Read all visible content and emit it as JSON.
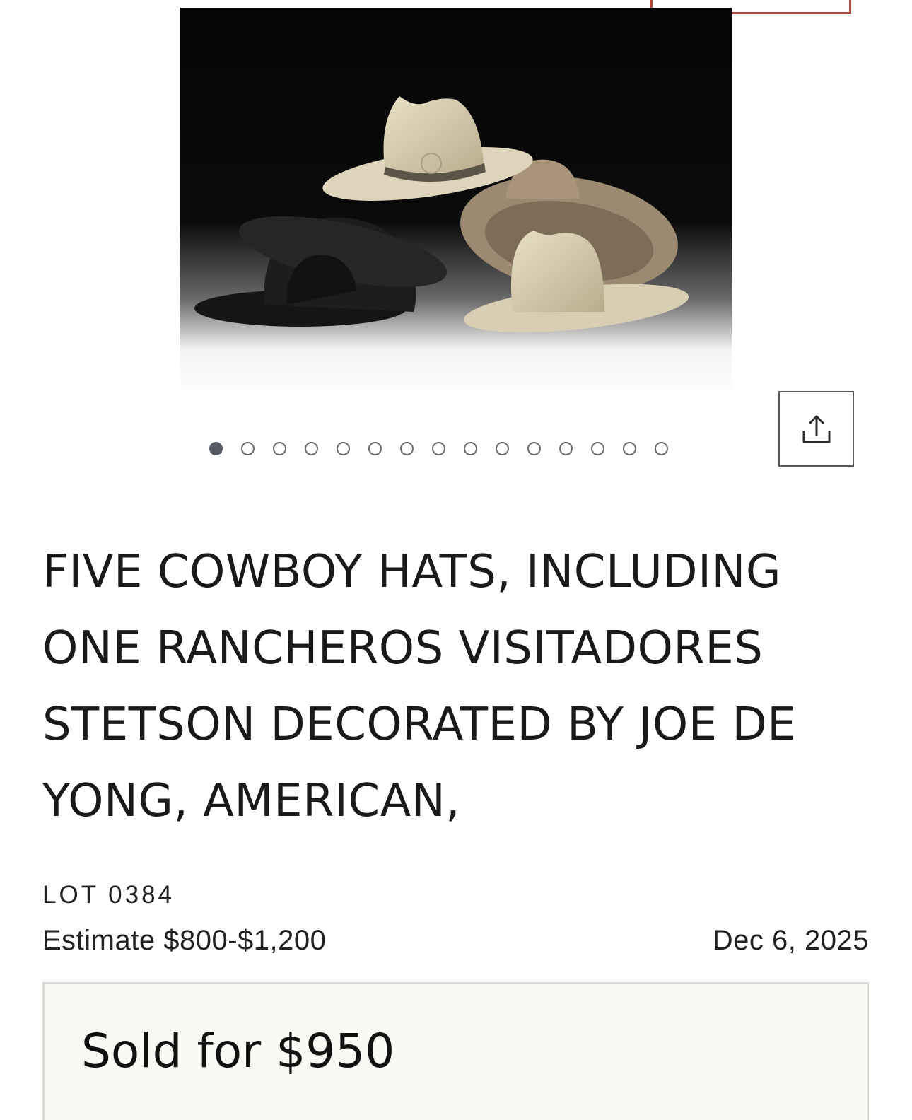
{
  "gallery": {
    "image_alt": "Five cowboy hats photographed on a black background",
    "dot_count": 15,
    "active_dot_index": 0
  },
  "share": {
    "icon": "share-icon"
  },
  "lot": {
    "title": "FIVE COWBOY HATS, INCLUDING ONE RANCHEROS VISITADORES STETSON DECORATED BY JOE DE YONG, AMERICAN,",
    "lot_number": "LOT 0384",
    "estimate": "Estimate $800-$1,200",
    "date": "Dec 6, 2025",
    "sold_text": "Sold for $950"
  },
  "colors": {
    "accent": "#b8453a",
    "sold_box_bg": "#fbf9f4",
    "active_dot": "#555a63"
  }
}
